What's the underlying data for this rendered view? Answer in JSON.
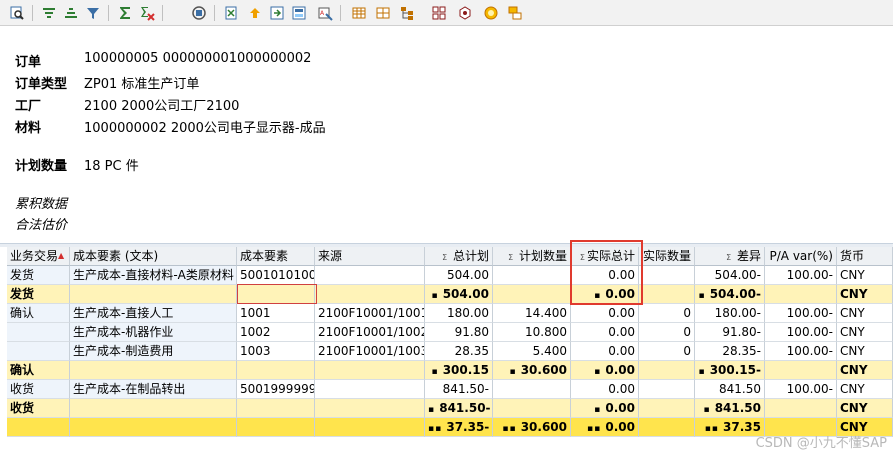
{
  "header": {
    "order_label": "订单",
    "order_value": "100000005 000000001000000002",
    "order_type_label": "订单类型",
    "order_type_value": "ZP01 标准生产订单",
    "plant_label": "工厂",
    "plant_value": "2100 2000公司工厂2100",
    "material_label": "材料",
    "material_value": "1000000002 2000公司电子显示器-成品",
    "planned_qty_label": "计划数量",
    "planned_qty_value": "18 PC 件",
    "cumulative_data": "累积数据",
    "legal_valuation": "合法估价"
  },
  "grid": {
    "columns": [
      "业务交易",
      "成本要素 (文本)",
      "成本要素",
      "来源",
      "总计划",
      "计划数量",
      "实际总计",
      "实际数量",
      "差异",
      "P/A var(%)",
      "货币"
    ],
    "rows": [
      {
        "type": "data",
        "c": [
          "发货",
          "生产成本-直接材料-A类原材料",
          "5001010100",
          "",
          "504.00",
          "",
          "0.00",
          "",
          "504.00-",
          "100.00-",
          "CNY"
        ]
      },
      {
        "type": "sum",
        "c": [
          "发货",
          "",
          "",
          "",
          "504.00",
          "",
          "0.00",
          "",
          "504.00-",
          "",
          "CNY"
        ]
      },
      {
        "type": "data",
        "c": [
          "确认",
          "生产成本-直接人工",
          "1001",
          "2100F10001/1001",
          "180.00",
          "14.400",
          "0.00",
          "0",
          "180.00-",
          "100.00-",
          "CNY"
        ]
      },
      {
        "type": "data",
        "c": [
          "",
          "生产成本-机器作业",
          "1002",
          "2100F10001/1002",
          "91.80",
          "10.800",
          "0.00",
          "0",
          "91.80-",
          "100.00-",
          "CNY"
        ]
      },
      {
        "type": "data",
        "c": [
          "",
          "生产成本-制造费用",
          "1003",
          "2100F10001/1003",
          "28.35",
          "5.400",
          "0.00",
          "0",
          "28.35-",
          "100.00-",
          "CNY"
        ]
      },
      {
        "type": "sum",
        "c": [
          "确认",
          "",
          "",
          "",
          "300.15",
          "30.600",
          "0.00",
          "",
          "300.15-",
          "",
          "CNY"
        ]
      },
      {
        "type": "data",
        "c": [
          "收货",
          "生产成本-在制品转出",
          "5001999999",
          "",
          "841.50-",
          "",
          "0.00",
          "",
          "841.50",
          "100.00-",
          "CNY"
        ]
      },
      {
        "type": "sum",
        "c": [
          "收货",
          "",
          "",
          "",
          "841.50-",
          "",
          "0.00",
          "",
          "841.50",
          "",
          "CNY"
        ]
      },
      {
        "type": "total",
        "c": [
          "",
          "",
          "",
          "",
          "37.35-",
          "30.600",
          "0.00",
          "",
          "37.35",
          "",
          "CNY"
        ]
      }
    ]
  },
  "watermark": "CSDN @小九不懂SAP",
  "colors": {
    "sum_row": "#fff3b8",
    "total_row": "#ffe44d",
    "highlight_box": "#e03a2e"
  }
}
